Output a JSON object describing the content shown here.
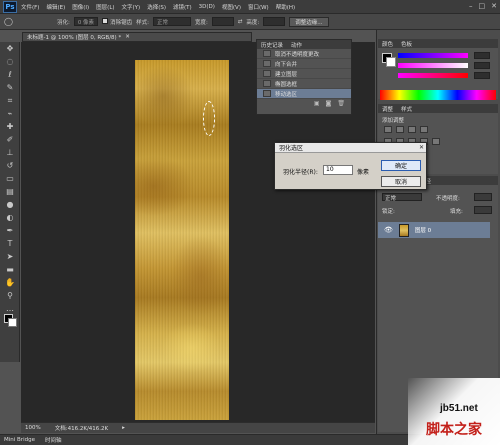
{
  "app": {
    "logo": "Ps"
  },
  "menubar": {
    "items": [
      "文件(F)",
      "编辑(E)",
      "图像(I)",
      "图层(L)",
      "文字(Y)",
      "选择(S)",
      "滤镜(T)",
      "3D(D)",
      "视图(V)",
      "窗口(W)",
      "帮助(H)"
    ]
  },
  "options": {
    "feather_label": "羽化:",
    "feather_value": "0 像素",
    "antialias_label": "消除锯齿",
    "style_label": "样式:",
    "style_value": "正常",
    "width_label": "宽度:",
    "height_label": "高度:",
    "refine_button": "调整边缘..."
  },
  "document": {
    "tab_title": "未标题-1 @ 100% (图层 0, RGB/8) *"
  },
  "status": {
    "zoom": "100%",
    "doc_info": "文档:416.2K/416.2K"
  },
  "bottom_tabs": [
    "Mini Bridge",
    "时间轴"
  ],
  "history": {
    "tabs": [
      "历史记录",
      "动作"
    ],
    "items": [
      "取消不透明度更改",
      "向下合并",
      "建立图层",
      "椭圆选框",
      "移动选区"
    ],
    "active_index": 4
  },
  "color_panel": {
    "tabs": [
      "颜色",
      "色板"
    ]
  },
  "adjust_panel": {
    "tabs": [
      "调整",
      "样式"
    ],
    "title": "添加调整"
  },
  "layers_panel": {
    "tabs": [
      "图层",
      "通道",
      "路径"
    ],
    "blend_mode": "正常",
    "opacity_label": "不透明度:",
    "lock_label": "锁定:",
    "fill_label": "填充:",
    "layer_name": "图层 0"
  },
  "dialog": {
    "title": "羽化选区",
    "radius_label": "羽化半径(R):",
    "radius_value": "10",
    "unit": "像素",
    "ok_label": "确定",
    "cancel_label": "取消"
  },
  "watermark": {
    "url": "jb51.net",
    "text": "脚本之家"
  },
  "colors": {
    "accent": "#6c7d95",
    "dialog_bg": "#d4d0c8",
    "canvas_bg": "#282828"
  }
}
